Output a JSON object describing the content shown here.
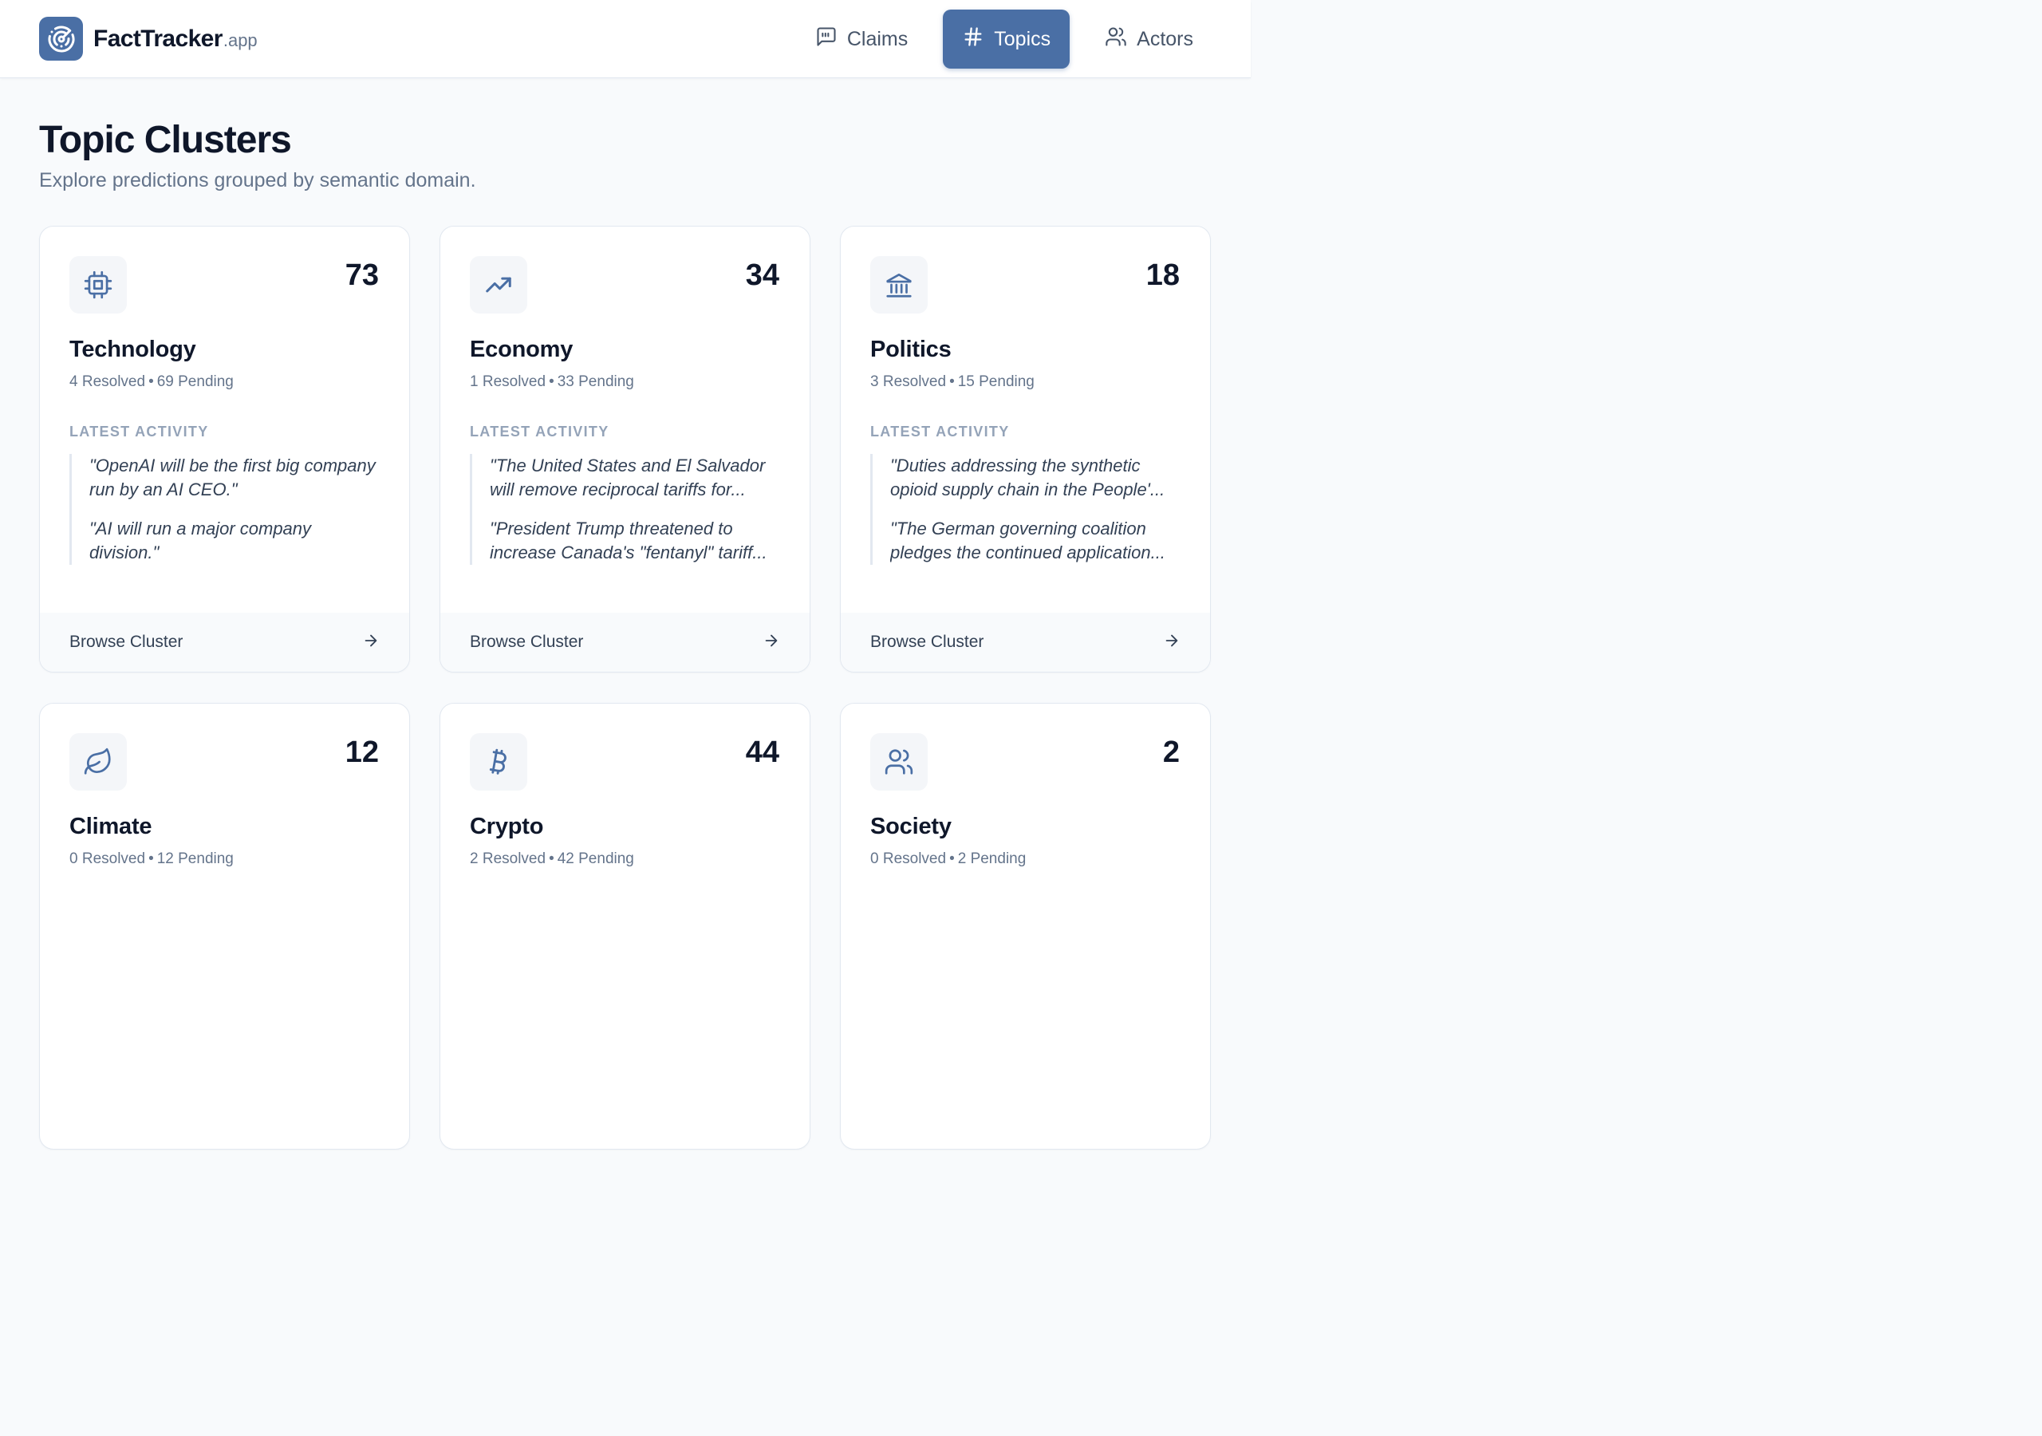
{
  "brand": {
    "name": "FactTracker",
    "tld": ".app",
    "logo_icon": "radar-icon",
    "color": "#4a6fa5"
  },
  "nav": [
    {
      "label": "Claims",
      "icon": "message-quote-icon",
      "active": false
    },
    {
      "label": "Topics",
      "icon": "hash-icon",
      "active": true
    },
    {
      "label": "Actors",
      "icon": "users-icon",
      "active": false
    }
  ],
  "page": {
    "title": "Topic Clusters",
    "subtitle": "Explore predictions grouped by semantic domain."
  },
  "cards": [
    {
      "icon": "cpu-icon",
      "count": "73",
      "title": "Technology",
      "resolved": "4 Resolved",
      "pending": "69 Pending",
      "activity_label": "LATEST ACTIVITY",
      "quotes": [
        "\"OpenAI will be the first big company run by an AI CEO.\"",
        "\"AI will run a major company division.\""
      ],
      "footer": "Browse Cluster"
    },
    {
      "icon": "trending-up-icon",
      "count": "34",
      "title": "Economy",
      "resolved": "1 Resolved",
      "pending": "33 Pending",
      "activity_label": "LATEST ACTIVITY",
      "quotes": [
        "\"The United States and El Salvador will remove reciprocal tariffs for...",
        "\"President Trump threatened to increase Canada's \"fentanyl\" tariff..."
      ],
      "footer": "Browse Cluster"
    },
    {
      "icon": "landmark-icon",
      "count": "18",
      "title": "Politics",
      "resolved": "3 Resolved",
      "pending": "15 Pending",
      "activity_label": "LATEST ACTIVITY",
      "quotes": [
        "\"Duties addressing the synthetic opioid supply chain in the People'...",
        "\"The German governing coalition pledges the continued application..."
      ],
      "footer": "Browse Cluster"
    },
    {
      "icon": "leaf-icon",
      "count": "12",
      "title": "Climate",
      "resolved": "0 Resolved",
      "pending": "12 Pending"
    },
    {
      "icon": "bitcoin-icon",
      "count": "44",
      "title": "Crypto",
      "resolved": "2 Resolved",
      "pending": "42 Pending"
    },
    {
      "icon": "users-icon",
      "count": "2",
      "title": "Society",
      "resolved": "0 Resolved",
      "pending": "2 Pending"
    }
  ],
  "colors": {
    "accent": "#4a6fa5",
    "text": "#0f172a",
    "muted": "#64748b",
    "label": "#94a3b8",
    "background": "#f8fafc"
  }
}
